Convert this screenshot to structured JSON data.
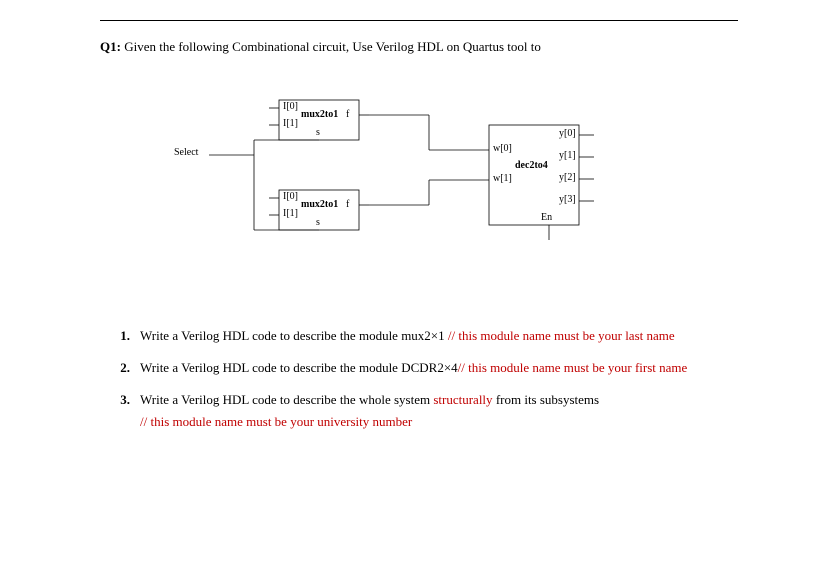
{
  "prompt": {
    "label": "Q1:",
    "text": "Given the following Combinational circuit, Use Verilog HDL on Quartus tool to"
  },
  "diagram": {
    "select_label": "Select",
    "mux1": {
      "name": "mux2to1",
      "in0": "I[0]",
      "in1": "I[1]",
      "sel": "s",
      "out": "f"
    },
    "mux2": {
      "name": "mux2to1",
      "in0": "I[0]",
      "in1": "I[1]",
      "sel": "s",
      "out": "f"
    },
    "dec": {
      "name": "dec2to4",
      "in0": "w[0]",
      "in1": "w[1]",
      "en": "En",
      "y0": "y[0]",
      "y1": "y[1]",
      "y2": "y[2]",
      "y3": "y[3]"
    }
  },
  "list": {
    "n1": "1.",
    "t1a": "Write a Verilog HDL code to describe the module mux2×1 ",
    "t1b": "// this module name must be your last name",
    "n2": "2.",
    "t2a": "Write a Verilog HDL code to describe the module DCDR2×4",
    "t2b": "// this module name must be your first name",
    "n3": "3.",
    "t3a": "Write a Verilog HDL code to describe the whole system ",
    "t3b": "structurally",
    "t3c": " from its subsystems",
    "t3d": "// this module name must be your university number"
  },
  "chart_data": {
    "type": "diagram",
    "circuit": {
      "components": [
        {
          "id": "mux_top",
          "type": "mux2to1",
          "inputs": [
            "I[0]",
            "I[1]"
          ],
          "select": "s",
          "output": "f"
        },
        {
          "id": "mux_bot",
          "type": "mux2to1",
          "inputs": [
            "I[0]",
            "I[1]"
          ],
          "select": "s",
          "output": "f"
        },
        {
          "id": "decoder",
          "type": "dec2to4",
          "inputs": [
            "w[0]",
            "w[1]"
          ],
          "enable": "En",
          "outputs": [
            "y[0]",
            "y[1]",
            "y[2]",
            "y[3]"
          ]
        }
      ],
      "connections": [
        {
          "from": "Select",
          "to": [
            "mux_top.s",
            "mux_bot.s"
          ]
        },
        {
          "from": "mux_top.f",
          "to": "decoder.w[0]"
        },
        {
          "from": "mux_bot.f",
          "to": "decoder.w[1]"
        }
      ]
    }
  }
}
